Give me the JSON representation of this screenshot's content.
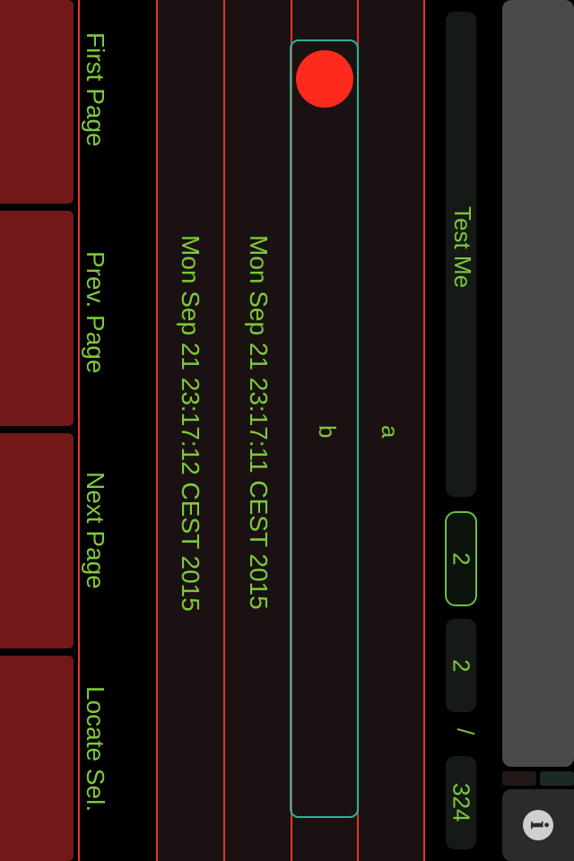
{
  "nav": {
    "first_page": "First Page",
    "prev_page": "Prev. Page",
    "next_page": "Next Page",
    "locate_sel": "Locate Sel."
  },
  "rows": [
    {
      "timestamp": "Mon Sep 21 23:17:12 CEST 2015"
    },
    {
      "timestamp": "Mon Sep 21 23:17:11 CEST 2015"
    }
  ],
  "selection": {
    "label_b": "b",
    "label_a": "a"
  },
  "toolbar": {
    "title": "Test Me",
    "page_input": "2",
    "page_current": "2",
    "separator": "/",
    "page_total": "324"
  },
  "icons": {
    "info": "info-icon"
  },
  "colors": {
    "accent_green": "#7ec93a",
    "nav_red": "#731818",
    "line_red": "#e2352a",
    "selection_teal": "#26b59a",
    "record_red": "#ff2a1e"
  }
}
